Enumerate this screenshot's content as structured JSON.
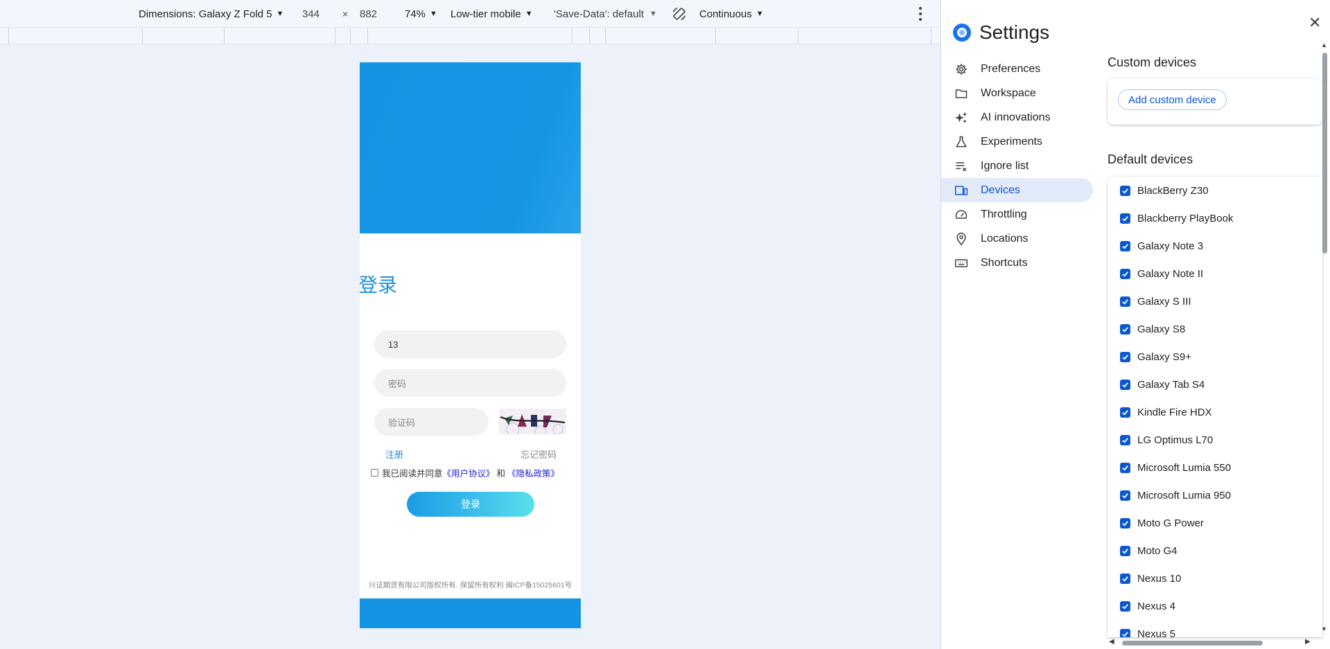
{
  "toolbar": {
    "dimensions_label": "Dimensions: Galaxy Z Fold 5",
    "width": "344",
    "times": "×",
    "height": "882",
    "zoom": "74%",
    "throttling": "Low-tier mobile",
    "save_data": "'Save-Data': default",
    "mode": "Continuous"
  },
  "device_page": {
    "title": "登录",
    "phone_value": "13",
    "password_placeholder": "密码",
    "code_placeholder": "验证码",
    "register": "注册",
    "forgot": "忘记密码",
    "agree_prefix": "我已阅读并同意",
    "user_agreement": "《用户协议》",
    "and": "和",
    "privacy_policy": "《隐私政策》",
    "login_button": "登录",
    "footer": "兴证期货有限公司版权所有. 保留所有权利 闽ICP备15025601号"
  },
  "settings": {
    "title": "Settings",
    "nav": [
      {
        "label": "Preferences",
        "icon": "gear-icon"
      },
      {
        "label": "Workspace",
        "icon": "folder-icon"
      },
      {
        "label": "AI innovations",
        "icon": "sparkle-icon"
      },
      {
        "label": "Experiments",
        "icon": "flask-icon"
      },
      {
        "label": "Ignore list",
        "icon": "ignore-list-icon"
      },
      {
        "label": "Devices",
        "icon": "devices-icon"
      },
      {
        "label": "Throttling",
        "icon": "gauge-icon"
      },
      {
        "label": "Locations",
        "icon": "location-pin-icon"
      },
      {
        "label": "Shortcuts",
        "icon": "keyboard-icon"
      }
    ],
    "active_nav": "Devices",
    "custom_devices_heading": "Custom devices",
    "add_custom_device": "Add custom device",
    "default_devices_heading": "Default devices",
    "devices": [
      "BlackBerry Z30",
      "Blackberry PlayBook",
      "Galaxy Note 3",
      "Galaxy Note II",
      "Galaxy S III",
      "Galaxy S8",
      "Galaxy S9+",
      "Galaxy Tab S4",
      "Kindle Fire HDX",
      "LG Optimus L70",
      "Microsoft Lumia 550",
      "Microsoft Lumia 950",
      "Moto G Power",
      "Moto G4",
      "Nexus 10",
      "Nexus 4",
      "Nexus 5"
    ],
    "accent_color": "#0b57d0"
  }
}
